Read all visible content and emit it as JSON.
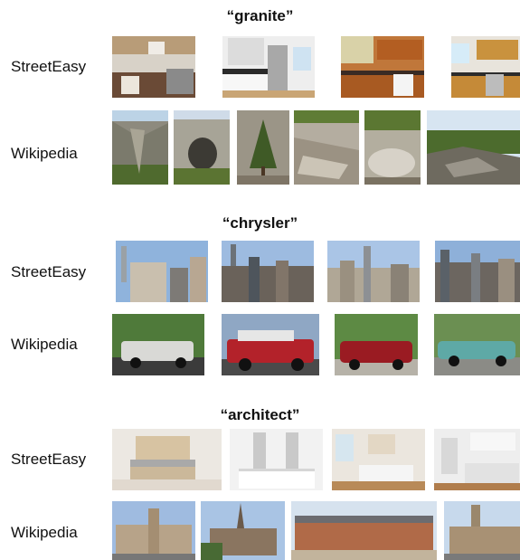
{
  "groups": [
    {
      "query": "“granite”",
      "rows": [
        {
          "source": "StreetEasy",
          "images": [
            "kitchen-photo",
            "kitchen-photo",
            "kitchen-photo",
            "kitchen-photo"
          ]
        },
        {
          "source": "Wikipedia",
          "images": [
            "granite-rock-photo",
            "granite-rock-photo",
            "granite-rock-photo",
            "granite-rock-photo",
            "granite-rock-photo",
            "granite-rock-photo"
          ]
        }
      ]
    },
    {
      "query": "“chrysler”",
      "rows": [
        {
          "source": "StreetEasy",
          "images": [
            "skyline-photo",
            "skyline-photo",
            "skyline-photo",
            "skyline-photo"
          ]
        },
        {
          "source": "Wikipedia",
          "images": [
            "car-photo",
            "car-photo",
            "car-photo",
            "car-photo"
          ]
        }
      ]
    },
    {
      "query": "“architect”",
      "rows": [
        {
          "source": "StreetEasy",
          "images": [
            "interior-photo",
            "interior-photo",
            "interior-photo",
            "interior-photo"
          ]
        },
        {
          "source": "Wikipedia",
          "images": [
            "building-photo",
            "building-photo",
            "building-photo",
            "building-photo"
          ]
        }
      ]
    }
  ]
}
